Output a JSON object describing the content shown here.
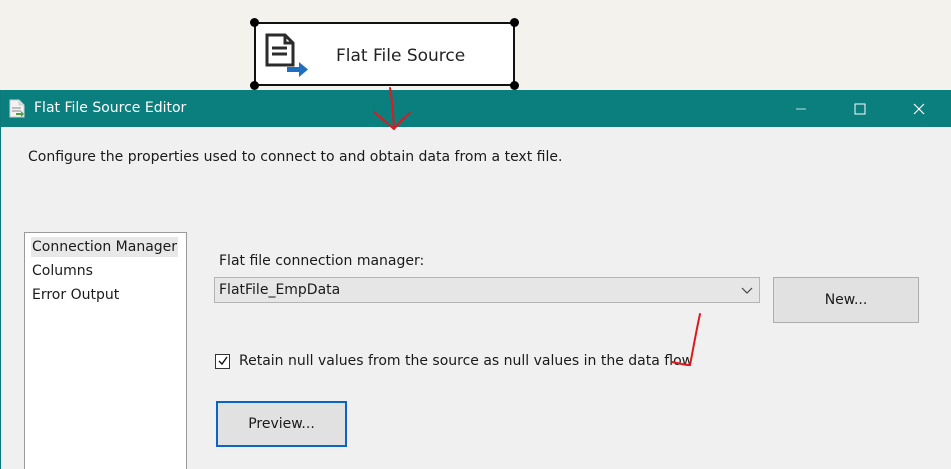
{
  "canvas": {
    "task": {
      "label": "Flat File Source",
      "icon": "flat-file-source-icon"
    }
  },
  "dialog": {
    "title": "Flat File Source Editor",
    "description": "Configure the properties used to connect to and obtain data from a text file.",
    "window_buttons": {
      "minimize": "minimize-icon",
      "maximize": "maximize-icon",
      "close": "close-icon"
    },
    "nav": {
      "items": [
        {
          "label": "Connection Manager",
          "selected": true
        },
        {
          "label": "Columns",
          "selected": false
        },
        {
          "label": "Error Output",
          "selected": false
        }
      ]
    },
    "connection": {
      "label": "Flat file connection manager:",
      "selected_value": "FlatFile_EmpData",
      "new_button": "New..."
    },
    "retain_nulls": {
      "label": "Retain null values from the source as null values in the data flow",
      "checked": true
    },
    "preview_button": "Preview..."
  },
  "colors": {
    "titlebar": "#0b7e7e",
    "annotation": "#e0191e",
    "preview_focus": "#0a64c8"
  }
}
